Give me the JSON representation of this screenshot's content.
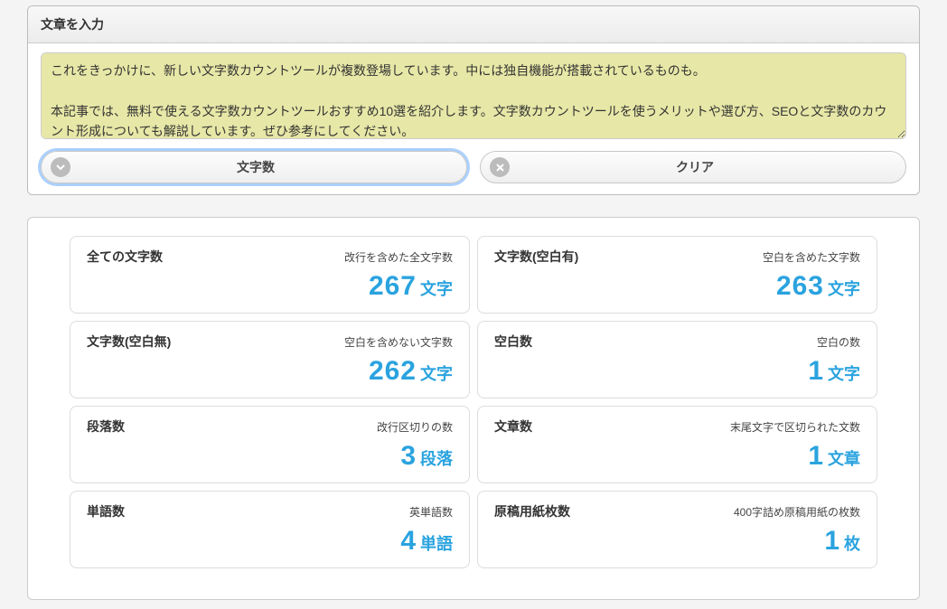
{
  "input": {
    "header": "文章を入力",
    "text": "これをきっかけに、新しい文字数カウントツールが複数登場しています。中には独自機能が搭載されているものも。\n\n本記事では、無料で使える文字数カウントツールおすすめ10選を紹介します。文字数カウントツールを使うメリットや選び方、SEOと文字数のカウント形成についても解説しています。ぜひ参考にしてください。"
  },
  "buttons": {
    "count": "文字数",
    "clear": "クリア"
  },
  "stats": [
    {
      "title": "全ての文字数",
      "desc": "改行を含めた全文字数",
      "value": "267",
      "unit": "文字"
    },
    {
      "title": "文字数(空白有)",
      "desc": "空白を含めた文字数",
      "value": "263",
      "unit": "文字"
    },
    {
      "title": "文字数(空白無)",
      "desc": "空白を含めない文字数",
      "value": "262",
      "unit": "文字"
    },
    {
      "title": "空白数",
      "desc": "空白の数",
      "value": "1",
      "unit": "文字"
    },
    {
      "title": "段落数",
      "desc": "改行区切りの数",
      "value": "3",
      "unit": "段落"
    },
    {
      "title": "文章数",
      "desc": "末尾文字で区切られた文数",
      "value": "1",
      "unit": "文章"
    },
    {
      "title": "単語数",
      "desc": "英単語数",
      "value": "4",
      "unit": "単語"
    },
    {
      "title": "原稿用紙枚数",
      "desc": "400字詰め原稿用紙の枚数",
      "value": "1",
      "unit": "枚"
    }
  ]
}
